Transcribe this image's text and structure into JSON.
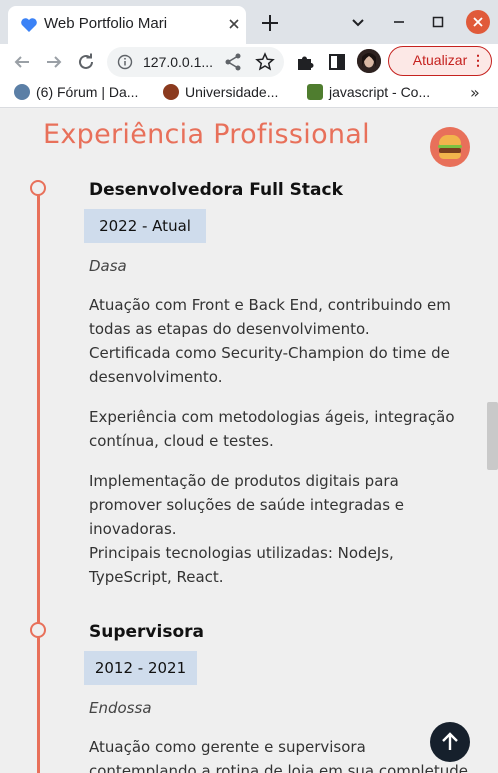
{
  "browser": {
    "tab_title": "Web Portfolio Mari",
    "url": "127.0.0.1...",
    "update_label": "Atualizar",
    "bookmarks": [
      {
        "label": "(6) Fórum | Da..."
      },
      {
        "label": "Universidade..."
      },
      {
        "label": "javascript - Co..."
      }
    ],
    "bookmarks_more": "»",
    "icons": {
      "favicon": "heart-icon",
      "tab_close": "close-icon",
      "new_tab": "plus-icon",
      "chevron": "chevron-down-icon",
      "minimize": "minimize-icon",
      "maximize": "maximize-icon",
      "window_close": "close-icon",
      "back": "back-arrow-icon",
      "forward": "forward-arrow-icon",
      "reload": "reload-icon",
      "site_info": "info-icon",
      "share": "share-icon",
      "bookmark_star": "star-icon",
      "extensions": "puzzle-icon",
      "side_panel": "side-panel-icon"
    }
  },
  "page": {
    "section_title": "Experiência Profissional",
    "jobs": [
      {
        "title": "Desenvolvedora Full Stack",
        "period": "2022 - Atual",
        "company": "Dasa",
        "paragraphs": [
          "Atuação com Front e Back End, contribuindo em todas as etapas do desenvolvimento.\nCertificada como Security-Champion do time de desenvolvimento.",
          "Experiência com metodologias ágeis, integração contínua, cloud e testes.",
          "Implementação de produtos digitais para promover soluções de saúde integradas e inovadoras.\nPrincipais tecnologias utilizadas: NodeJs, TypeScript, React."
        ]
      },
      {
        "title": "Supervisora",
        "period": "2012 - 2021",
        "company": "Endossa",
        "paragraphs": [
          "Atuação como gerente e supervisora contemplando a rotina de loja em sua completude"
        ]
      }
    ]
  },
  "colors": {
    "accent": "#e8705a",
    "period_bg": "#cfdcec",
    "to_top_bg": "#16202c",
    "update_red": "#c5221f"
  }
}
